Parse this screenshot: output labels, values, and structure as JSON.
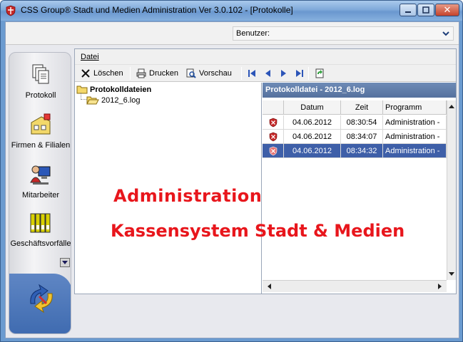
{
  "window": {
    "title": "CSS Group® Stadt und Medien Administration Ver 3.0.102 - [Protokolle]",
    "close_glyph": "✕"
  },
  "userbar": {
    "label": "Benutzer:"
  },
  "nav": {
    "items": [
      {
        "label": "Protokoll",
        "icon": "document-icon"
      },
      {
        "label": "Firmen & Filialen",
        "icon": "building-icon"
      },
      {
        "label": "Mitarbeiter",
        "icon": "employee-icon"
      },
      {
        "label": "Geschäftsvorfälle",
        "icon": "binders-icon"
      }
    ]
  },
  "menu": {
    "datei": "Datei"
  },
  "toolbar": {
    "loeschen": "Löschen",
    "drucken": "Drucken",
    "vorschau": "Vorschau"
  },
  "tree": {
    "root": "Protokolldateien",
    "child": "2012_6.log"
  },
  "grid": {
    "title": "Protokolldatei - 2012_6.log",
    "columns": [
      "",
      "Datum",
      "Zeit",
      "Programm"
    ],
    "rows": [
      {
        "datum": "04.06.2012",
        "zeit": "08:30:54",
        "programm": "Administration -"
      },
      {
        "datum": "04.06.2012",
        "zeit": "08:34:07",
        "programm": "Administration -"
      },
      {
        "datum": "04.06.2012",
        "zeit": "08:34:32",
        "programm": "Administration -"
      }
    ]
  },
  "overlay": {
    "line1": "Administration",
    "line2": "Kassensystem Stadt & Medien"
  },
  "colors": {
    "titlebar": "#7fa9da",
    "selection": "#3e5fa8",
    "grid_title": "#5f7aa6",
    "overlay_text": "#e8161c"
  }
}
